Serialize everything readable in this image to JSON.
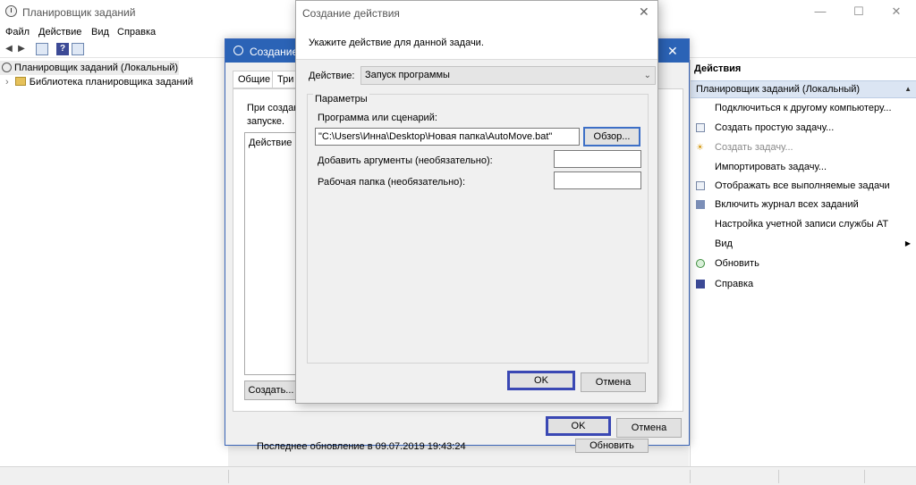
{
  "window": {
    "title": "Планировщик заданий",
    "controls": [
      "—",
      "☐",
      "✕"
    ]
  },
  "menu": [
    "Файл",
    "Действие",
    "Вид",
    "Справка"
  ],
  "tree": {
    "root": "Планировщик заданий (Локальный)",
    "child": "Библиотека планировщика заданий"
  },
  "actions_pane": {
    "header": "Действия",
    "section": "Планировщик заданий (Локальный)",
    "items": [
      {
        "label": "Подключиться к другому компьютеру...",
        "icon": "none"
      },
      {
        "label": "Создать простую задачу...",
        "icon": "task-icon"
      },
      {
        "label": "Создать задачу...",
        "icon": "sun-icon"
      },
      {
        "label": "Импортировать задачу...",
        "icon": "none"
      },
      {
        "label": "Отображать все выполняемые задачи",
        "icon": "list-icon"
      },
      {
        "label": "Включить журнал всех заданий",
        "icon": "log-icon"
      },
      {
        "label": "Настройка учетной записи службы AT",
        "icon": "none"
      },
      {
        "label": "Вид",
        "icon": "none"
      },
      {
        "label": "Обновить",
        "icon": "refresh-icon"
      },
      {
        "label": "Справка",
        "icon": "help-icon"
      }
    ]
  },
  "task_dialog": {
    "title": "Создание з",
    "tabs": [
      "Общие",
      "Три"
    ],
    "text_line1": "При создан",
    "text_line2": "запуске.",
    "list_header": "Действие",
    "create_button": "Создать...",
    "ok": "OK",
    "cancel": "Отмена",
    "status_behind": "Последнее обновление в 09.07.2019 19:43:24",
    "refresh_behind": "Обновить"
  },
  "action_dialog": {
    "title": "Создание действия",
    "prompt": "Укажите действие для данной задачи.",
    "action_label": "Действие:",
    "action_value": "Запуск программы",
    "group_label": "Параметры",
    "program_label": "Программа или сценарий:",
    "program_value": "\"C:\\Users\\Инна\\Desktop\\Новая папка\\AutoMove.bat\"",
    "browse": "Обзор...",
    "args_label": "Добавить аргументы (необязательно):",
    "args_value": "",
    "workdir_label": "Рабочая папка (необязательно):",
    "workdir_value": "",
    "ok": "OK",
    "cancel": "Отмена"
  },
  "colors": {
    "accent": "#2b63b6",
    "focus_outline": "#3a48b4",
    "selection": "#dbe5f3"
  }
}
